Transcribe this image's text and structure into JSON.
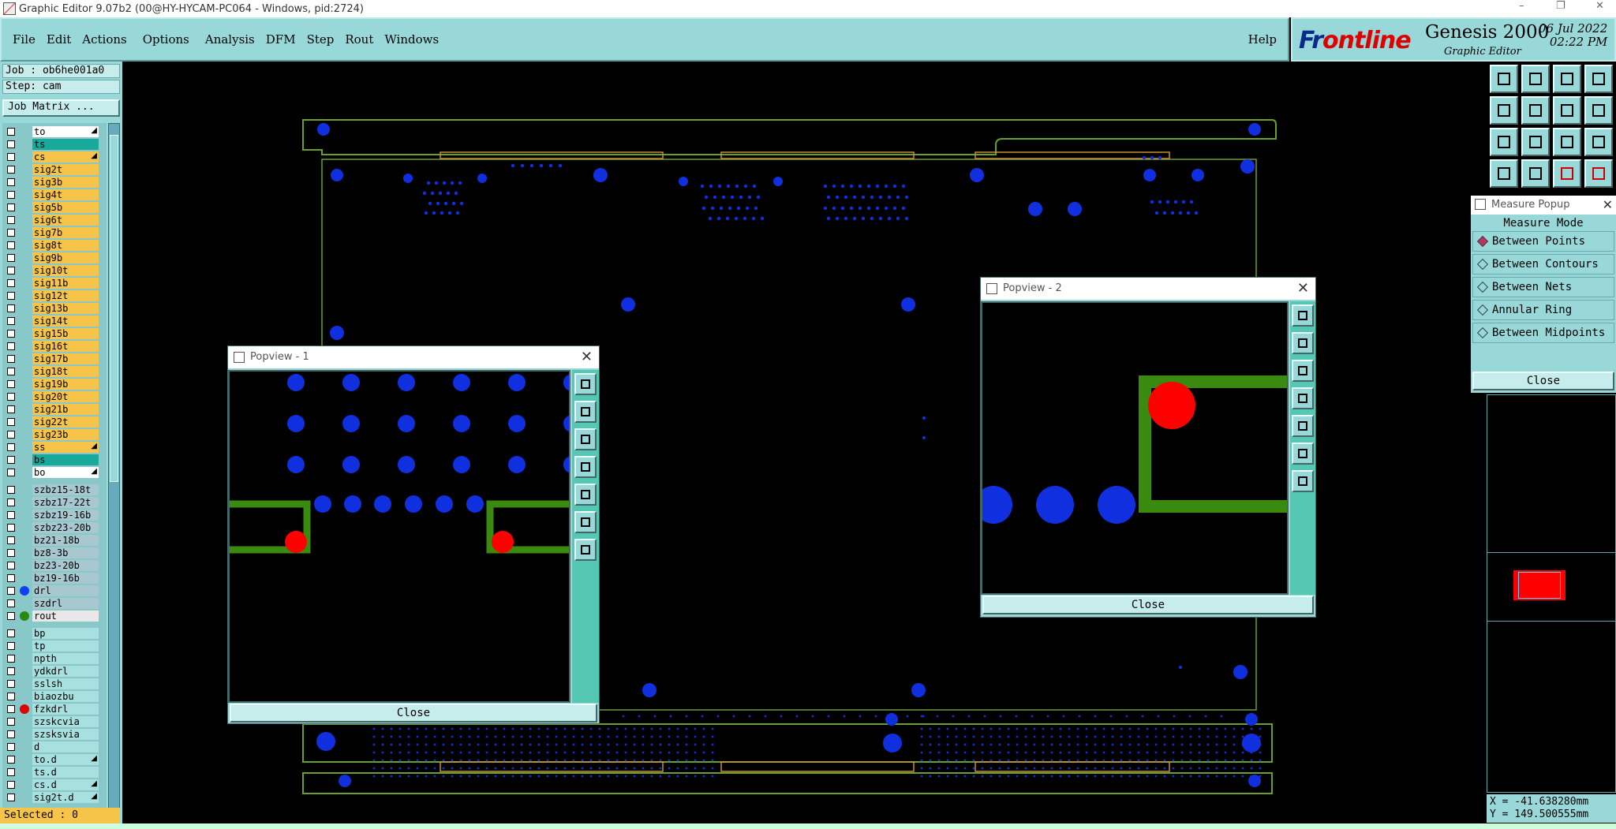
{
  "window": {
    "title": "Graphic Editor 9.07b2 (00@HY-HYCAM-PC064 - Windows, pid:2724)",
    "minimize": "–",
    "restore": "❐",
    "close": "✕"
  },
  "menubar": {
    "items": [
      "File",
      "Edit",
      "Actions",
      "Options",
      "Analysis",
      "DFM",
      "Step",
      "Rout",
      "Windows"
    ],
    "help": "Help"
  },
  "brand": {
    "logo_prefix": "Fr",
    "logo_rest": "ontline",
    "product": "Genesis 2000",
    "subtitle": "Graphic Editor",
    "date": "06 Jul 2022",
    "time": "02:22 PM"
  },
  "left": {
    "job": "Job : ob6he001a0",
    "step": "Step: cam",
    "job_matrix": "Job Matrix ...",
    "selected": "Selected : 0"
  },
  "layers": [
    {
      "name": "to",
      "color": "#ffffff",
      "arrow": true
    },
    {
      "name": "ts",
      "color": "#1aa89a",
      "arrow": false
    },
    {
      "name": "cs",
      "color": "#f7c44a",
      "arrow": true
    },
    {
      "name": "sig2t",
      "color": "#f7c44a",
      "arrow": false
    },
    {
      "name": "sig3b",
      "color": "#f7c44a",
      "arrow": false
    },
    {
      "name": "sig4t",
      "color": "#f7c44a",
      "arrow": false
    },
    {
      "name": "sig5b",
      "color": "#f7c44a",
      "arrow": false
    },
    {
      "name": "sig6t",
      "color": "#f7c44a",
      "arrow": false
    },
    {
      "name": "sig7b",
      "color": "#f7c44a",
      "arrow": false
    },
    {
      "name": "sig8t",
      "color": "#f7c44a",
      "arrow": false
    },
    {
      "name": "sig9b",
      "color": "#f7c44a",
      "arrow": false
    },
    {
      "name": "sig10t",
      "color": "#f7c44a",
      "arrow": false
    },
    {
      "name": "sig11b",
      "color": "#f7c44a",
      "arrow": false
    },
    {
      "name": "sig12t",
      "color": "#f7c44a",
      "arrow": false
    },
    {
      "name": "sig13b",
      "color": "#f7c44a",
      "arrow": false
    },
    {
      "name": "sig14t",
      "color": "#f7c44a",
      "arrow": false
    },
    {
      "name": "sig15b",
      "color": "#f7c44a",
      "arrow": false
    },
    {
      "name": "sig16t",
      "color": "#f7c44a",
      "arrow": false
    },
    {
      "name": "sig17b",
      "color": "#f7c44a",
      "arrow": false
    },
    {
      "name": "sig18t",
      "color": "#f7c44a",
      "arrow": false
    },
    {
      "name": "sig19b",
      "color": "#f7c44a",
      "arrow": false
    },
    {
      "name": "sig20t",
      "color": "#f7c44a",
      "arrow": false
    },
    {
      "name": "sig21b",
      "color": "#f7c44a",
      "arrow": false
    },
    {
      "name": "sig22t",
      "color": "#f7c44a",
      "arrow": false
    },
    {
      "name": "sig23b",
      "color": "#f7c44a",
      "arrow": false
    },
    {
      "name": "ss",
      "color": "#f7c44a",
      "arrow": true
    },
    {
      "name": "bs",
      "color": "#1aa89a",
      "arrow": false
    },
    {
      "name": "bo",
      "color": "#ffffff",
      "arrow": true
    },
    {
      "name": "szbz15-18t",
      "color": "#a8c8d0",
      "arrow": false
    },
    {
      "name": "szbz17-22t",
      "color": "#a8c8d0",
      "arrow": false
    },
    {
      "name": "szbz19-16b",
      "color": "#a8c8d0",
      "arrow": false
    },
    {
      "name": "szbz23-20b",
      "color": "#a8c8d0",
      "arrow": false
    },
    {
      "name": "bz21-18b",
      "color": "#a8c8d0",
      "arrow": false
    },
    {
      "name": "bz8-3b",
      "color": "#a8c8d0",
      "arrow": false
    },
    {
      "name": "bz23-20b",
      "color": "#a8c8d0",
      "arrow": false
    },
    {
      "name": "bz19-16b",
      "color": "#a8c8d0",
      "arrow": false
    },
    {
      "name": "drl",
      "color": "#a8c8d0",
      "arrow": false,
      "dot": "#1040f0"
    },
    {
      "name": "szdrl",
      "color": "#a8c8d0",
      "arrow": false
    },
    {
      "name": "rout",
      "color": "#e8e8e8",
      "arrow": false,
      "dot": "#2a8a10",
      "active": true
    },
    {
      "name": "bp",
      "color": "#a8e0e0",
      "arrow": false
    },
    {
      "name": "tp",
      "color": "#a8e0e0",
      "arrow": false
    },
    {
      "name": "npth",
      "color": "#a8e0e0",
      "arrow": false
    },
    {
      "name": "ydkdrl",
      "color": "#a8e0e0",
      "arrow": false
    },
    {
      "name": "sslsh",
      "color": "#a8e0e0",
      "arrow": false
    },
    {
      "name": "biaozbu",
      "color": "#a8e0e0",
      "arrow": false
    },
    {
      "name": "fzkdrl",
      "color": "#a8e0e0",
      "arrow": false,
      "dot": "#e00000"
    },
    {
      "name": "szskcvia",
      "color": "#a8e0e0",
      "arrow": false
    },
    {
      "name": "szsksvia",
      "color": "#a8e0e0",
      "arrow": false
    },
    {
      "name": "d",
      "color": "#a8e0e0",
      "arrow": false
    },
    {
      "name": "to.d",
      "color": "#a8e0e0",
      "arrow": true
    },
    {
      "name": "ts.d",
      "color": "#a8e0e0",
      "arrow": false
    },
    {
      "name": "cs.d",
      "color": "#a8e0e0",
      "arrow": true
    },
    {
      "name": "sig2t.d",
      "color": "#a8e0e0",
      "arrow": true
    }
  ],
  "measure": {
    "title": "Measure Popup",
    "mode_label": "Measure Mode",
    "options": [
      "Between Points",
      "Between Contours",
      "Between Nets",
      "Annular Ring",
      "Between Midpoints"
    ],
    "selected_option": "Between Points",
    "close": "Close"
  },
  "popview1": {
    "title": "Popview - 1",
    "close": "Close"
  },
  "popview2": {
    "title": "Popview - 2",
    "close": "Close"
  },
  "coords": {
    "x": "X = -41.638280mm",
    "y": "Y = 149.500555mm"
  },
  "colors": {
    "panel": "#99d8d8",
    "rout": "#3a8a10",
    "pad": "#1030e0",
    "hit": "#ff0000",
    "outline": "#6aa028"
  },
  "tool_icons": [
    "zoom-in-icon",
    "zoom-out-icon",
    "home-icon",
    "layout-icon",
    "pan-left-icon",
    "pan-right-icon",
    "zoom-box-icon",
    "fit-icon",
    "fit-all-icon",
    "center-icon",
    "scale-icon",
    "help-icon",
    "snap-icon",
    "measure-icon",
    "layers-red-icon",
    "layers-red2-icon"
  ]
}
